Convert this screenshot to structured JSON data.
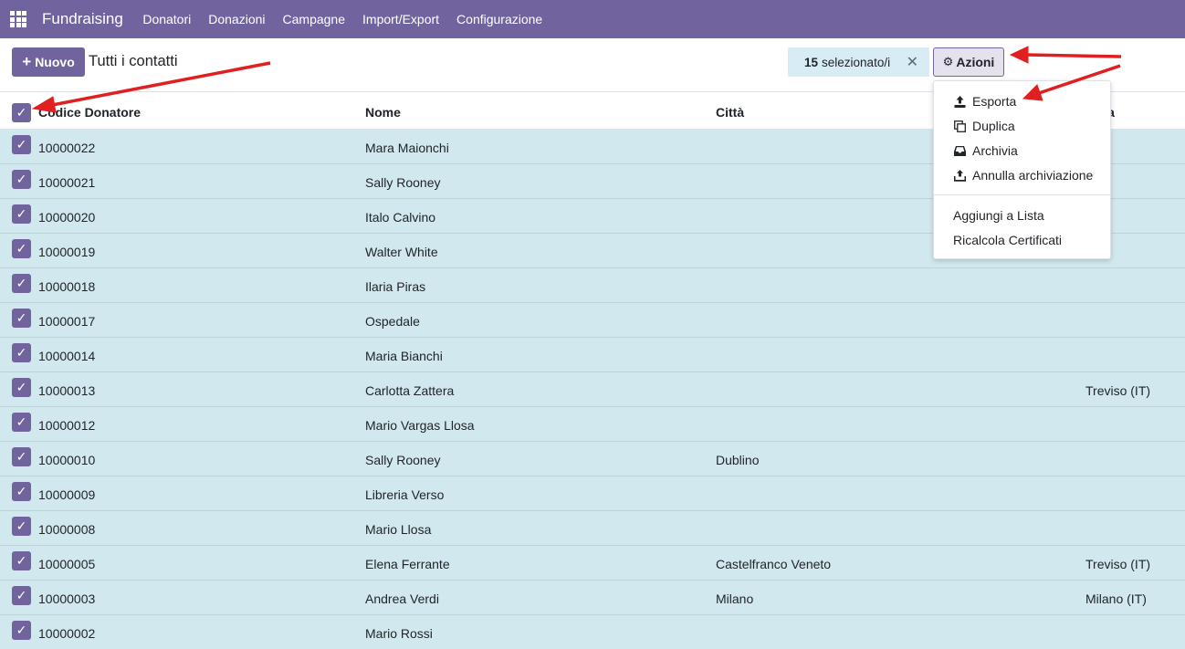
{
  "navbar": {
    "brand": "Fundraising",
    "items": [
      "Donatori",
      "Donazioni",
      "Campagne",
      "Import/Export",
      "Configurazione"
    ]
  },
  "control": {
    "new_label": "Nuovo",
    "breadcrumb": "Tutti i contatti",
    "selected_count": "15",
    "selected_label": "selezionato/i",
    "actions_label": "Azioni"
  },
  "table": {
    "headers": {
      "code": "Codice Donatore",
      "name": "Nome",
      "city": "Città",
      "province": "incia"
    },
    "rows": [
      {
        "code": "10000022",
        "name": "Mara Maionchi",
        "city": "",
        "province": ""
      },
      {
        "code": "10000021",
        "name": "Sally Rooney",
        "city": "",
        "province": ""
      },
      {
        "code": "10000020",
        "name": "Italo Calvino",
        "city": "",
        "province": ""
      },
      {
        "code": "10000019",
        "name": "Walter White",
        "city": "",
        "province": ""
      },
      {
        "code": "10000018",
        "name": "Ilaria Piras",
        "city": "",
        "province": ""
      },
      {
        "code": "10000017",
        "name": "Ospedale",
        "city": "",
        "province": ""
      },
      {
        "code": "10000014",
        "name": "Maria Bianchi",
        "city": "",
        "province": ""
      },
      {
        "code": "10000013",
        "name": "Carlotta Zattera",
        "city": "",
        "province": "Treviso (IT)"
      },
      {
        "code": "10000012",
        "name": "Mario Vargas Llosa",
        "city": "",
        "province": ""
      },
      {
        "code": "10000010",
        "name": "Sally Rooney",
        "city": "Dublino",
        "province": ""
      },
      {
        "code": "10000009",
        "name": "Libreria Verso",
        "city": "",
        "province": ""
      },
      {
        "code": "10000008",
        "name": "Mario Llosa",
        "city": "",
        "province": ""
      },
      {
        "code": "10000005",
        "name": "Elena Ferrante",
        "city": "Castelfranco Veneto",
        "province": "Treviso (IT)"
      },
      {
        "code": "10000003",
        "name": "Andrea Verdi",
        "city": "Milano",
        "province": "Milano (IT)"
      },
      {
        "code": "10000002",
        "name": "Mario Rossi",
        "city": "",
        "province": ""
      }
    ]
  },
  "dropdown": {
    "items": [
      {
        "label": "Esporta",
        "icon": "upload-icon"
      },
      {
        "label": "Duplica",
        "icon": "copy-icon"
      },
      {
        "label": "Archivia",
        "icon": "inbox-icon"
      },
      {
        "label": "Annulla archiviazione",
        "icon": "unarchive-icon"
      }
    ],
    "extra_items": [
      "Aggiungi a Lista",
      "Ricalcola Certificati"
    ]
  },
  "colors": {
    "brand": "#71639e",
    "row_selected": "#d1e9ee",
    "badge": "#d7ecf4",
    "arrow": "#e02020"
  }
}
